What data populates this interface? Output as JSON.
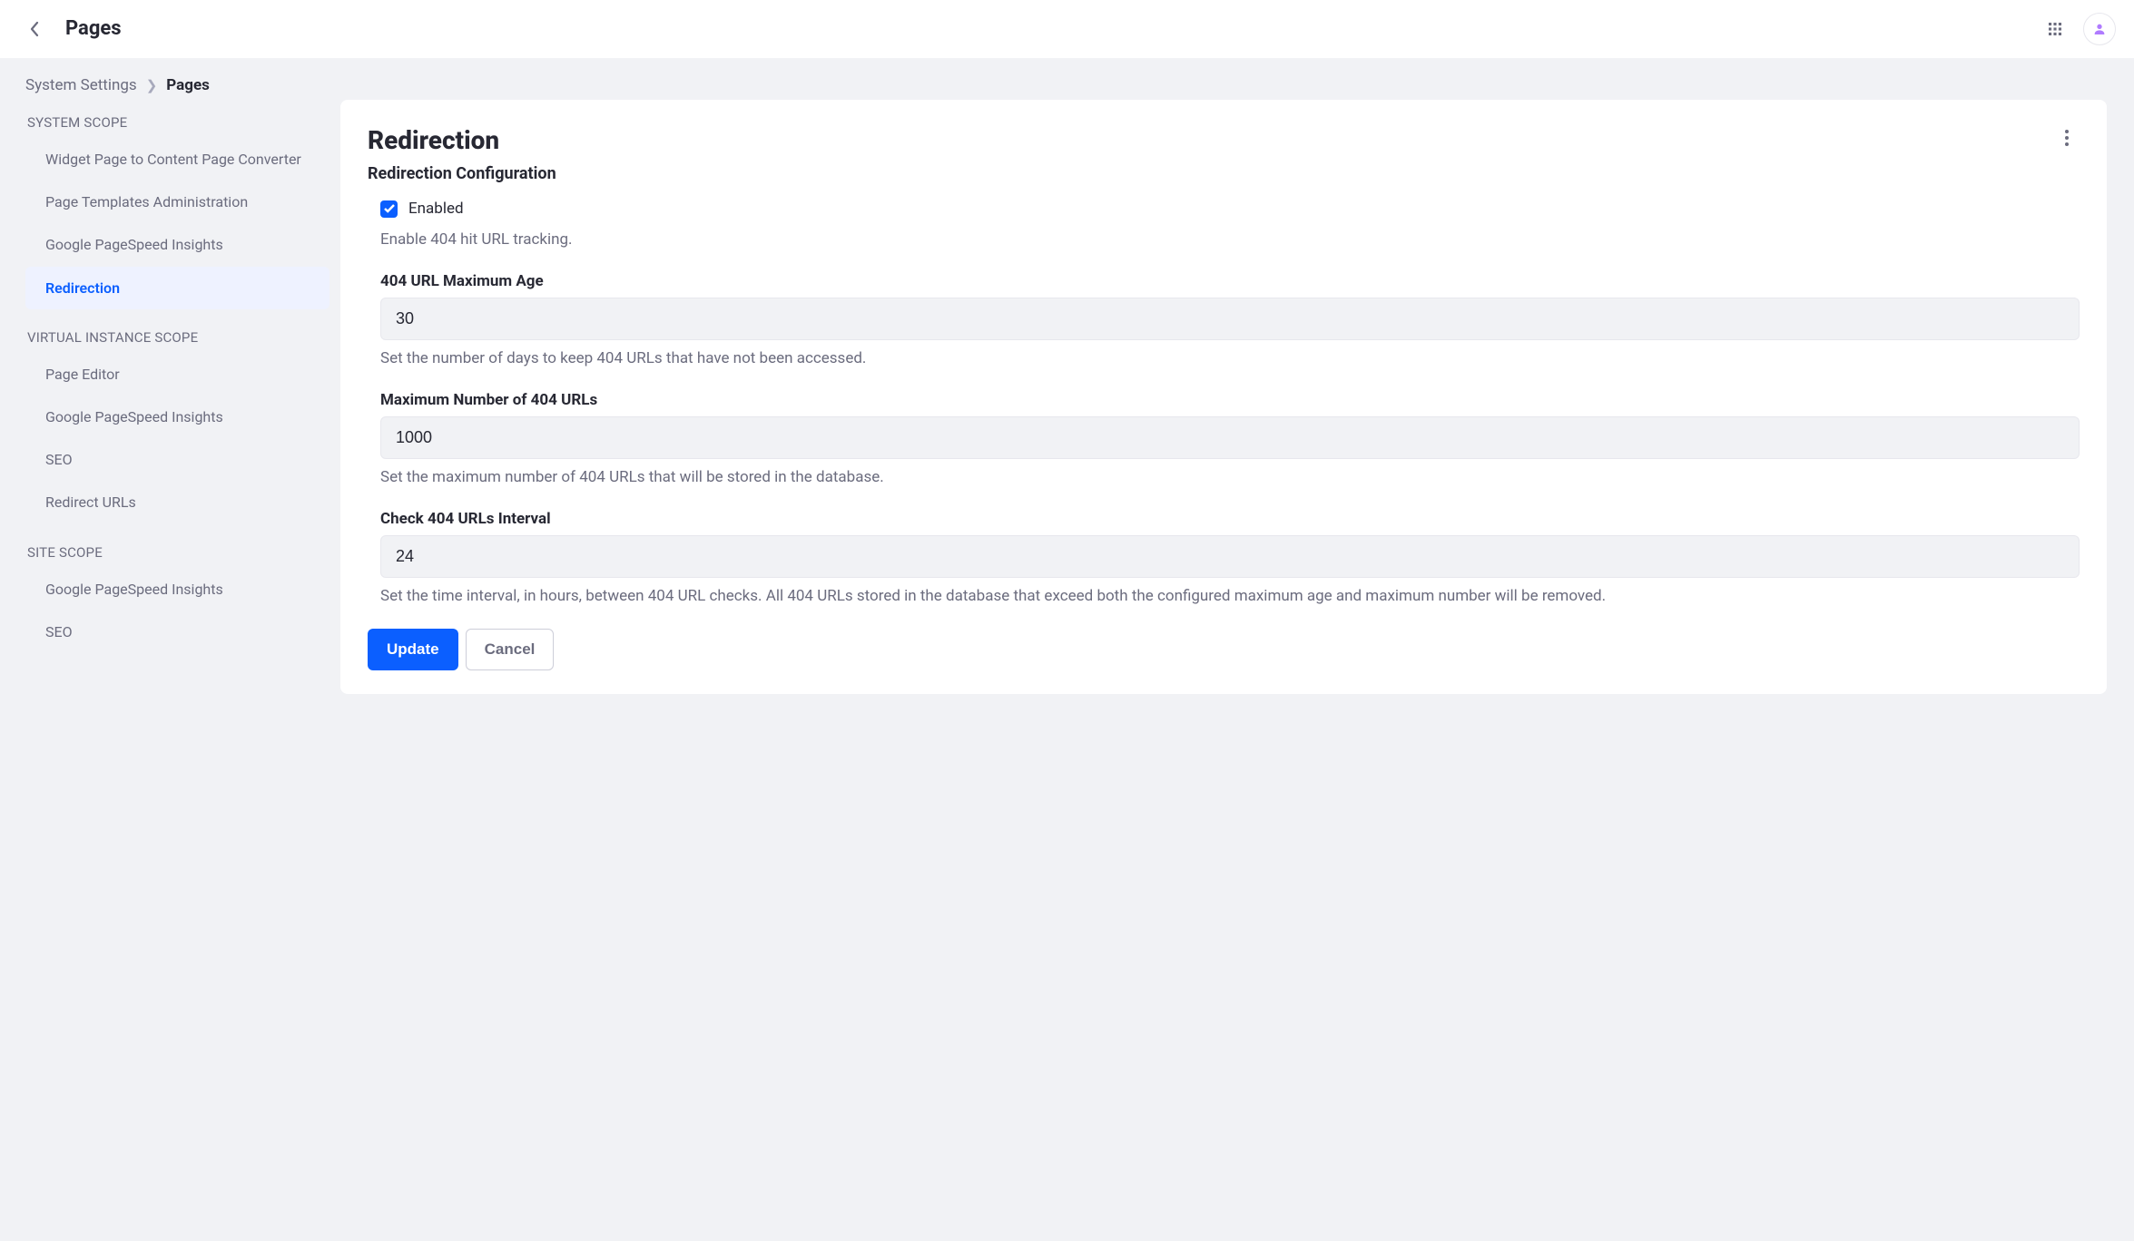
{
  "header": {
    "title": "Pages"
  },
  "breadcrumb": {
    "root": "System Settings",
    "current": "Pages"
  },
  "sidebar": {
    "scopes": [
      {
        "label": "SYSTEM SCOPE",
        "items": [
          {
            "label": "Widget Page to Content Page Converter",
            "active": false
          },
          {
            "label": "Page Templates Administration",
            "active": false
          },
          {
            "label": "Google PageSpeed Insights",
            "active": false
          },
          {
            "label": "Redirection",
            "active": true
          }
        ]
      },
      {
        "label": "VIRTUAL INSTANCE SCOPE",
        "items": [
          {
            "label": "Page Editor",
            "active": false
          },
          {
            "label": "Google PageSpeed Insights",
            "active": false
          },
          {
            "label": "SEO",
            "active": false
          },
          {
            "label": "Redirect URLs",
            "active": false
          }
        ]
      },
      {
        "label": "SITE SCOPE",
        "items": [
          {
            "label": "Google PageSpeed Insights",
            "active": false
          },
          {
            "label": "SEO",
            "active": false
          }
        ]
      }
    ]
  },
  "panel": {
    "title": "Redirection",
    "subtitle": "Redirection Configuration",
    "enabled": {
      "label": "Enabled",
      "checked": true,
      "hint": "Enable 404 hit URL tracking."
    },
    "fields": {
      "maxAge": {
        "label": "404 URL Maximum Age",
        "value": "30",
        "help": "Set the number of days to keep 404 URLs that have not been accessed."
      },
      "maxNumber": {
        "label": "Maximum Number of 404 URLs",
        "value": "1000",
        "help": "Set the maximum number of 404 URLs that will be stored in the database."
      },
      "checkInterval": {
        "label": "Check 404 URLs Interval",
        "value": "24",
        "help": "Set the time interval, in hours, between 404 URL checks. All 404 URLs stored in the database that exceed both the configured maximum age and maximum number will be removed."
      }
    },
    "actions": {
      "primary": "Update",
      "secondary": "Cancel"
    }
  }
}
